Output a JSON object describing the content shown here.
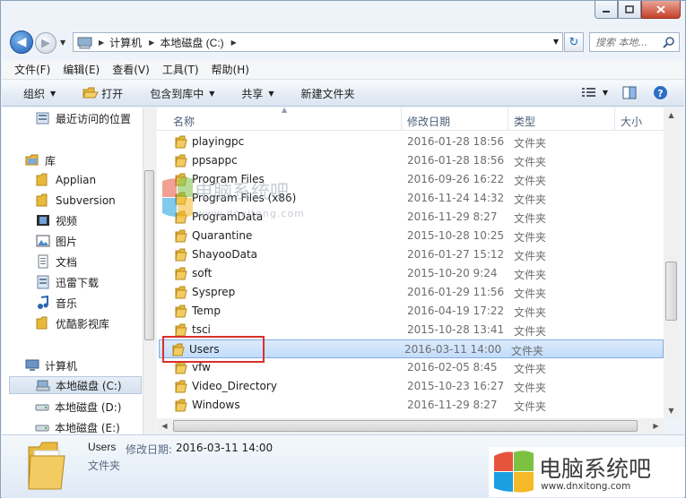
{
  "address": {
    "crumbs": [
      "计算机",
      "本地磁盘 (C:)"
    ]
  },
  "search": {
    "placeholder": "搜索 本地..."
  },
  "menu": [
    "文件(F)",
    "编辑(E)",
    "查看(V)",
    "工具(T)",
    "帮助(H)"
  ],
  "commands": {
    "organize": "组织",
    "open": "打开",
    "include_library": "包含到库中",
    "share": "共享",
    "new_folder": "新建文件夹"
  },
  "nav": {
    "recent": "最近访问的位置",
    "library": "库",
    "library_items": [
      "Applian",
      "Subversion",
      "视频",
      "图片",
      "文档",
      "迅雷下载",
      "音乐",
      "优酷影视库"
    ],
    "computer": "计算机",
    "drives": [
      "本地磁盘 (C:)",
      "本地磁盘 (D:)",
      "本地磁盘 (E:)"
    ]
  },
  "columns": {
    "name": "名称",
    "date": "修改日期",
    "type": "类型",
    "size": "大小"
  },
  "files": [
    {
      "name": "playingpc",
      "date": "2016-01-28 18:56",
      "type": "文件夹"
    },
    {
      "name": "ppsappc",
      "date": "2016-01-28 18:56",
      "type": "文件夹"
    },
    {
      "name": "Program Files",
      "date": "2016-09-26 16:22",
      "type": "文件夹"
    },
    {
      "name": "Program Files (x86)",
      "date": "2016-11-24 14:32",
      "type": "文件夹"
    },
    {
      "name": "ProgramData",
      "date": "2016-11-29 8:27",
      "type": "文件夹"
    },
    {
      "name": "Quarantine",
      "date": "2015-10-28 10:25",
      "type": "文件夹"
    },
    {
      "name": "ShayooData",
      "date": "2016-01-27 15:12",
      "type": "文件夹"
    },
    {
      "name": "soft",
      "date": "2015-10-20 9:24",
      "type": "文件夹"
    },
    {
      "name": "Sysprep",
      "date": "2016-01-29 11:56",
      "type": "文件夹"
    },
    {
      "name": "Temp",
      "date": "2016-04-19 17:22",
      "type": "文件夹"
    },
    {
      "name": "tsci",
      "date": "2015-10-28 13:41",
      "type": "文件夹"
    },
    {
      "name": "Users",
      "date": "2016-03-11 14:00",
      "type": "文件夹"
    },
    {
      "name": "vfw",
      "date": "2016-02-05 8:45",
      "type": "文件夹"
    },
    {
      "name": "Video_Directory",
      "date": "2015-10-23 16:27",
      "type": "文件夹"
    },
    {
      "name": "Windows",
      "date": "2016-11-29 8:27",
      "type": "文件夹"
    }
  ],
  "selected_index": 11,
  "details": {
    "name": "Users",
    "date_label": "修改日期:",
    "date_value": "2016-03-11 14:00",
    "type": "文件夹"
  },
  "watermark": {
    "center_title": "电脑系统吧",
    "center_url": "www.dnxitong.com",
    "corner_title": "电脑系统吧",
    "corner_url": "www.dnxitong.com"
  },
  "colors": {
    "folder": "#e8b93a",
    "selection": "#c1dcfc",
    "highlight_box": "#d9302a",
    "nav_selected": "#d5e1ef"
  }
}
